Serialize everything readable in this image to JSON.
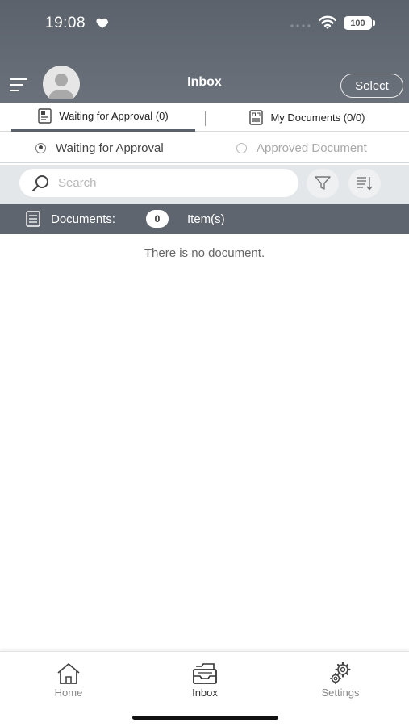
{
  "status_bar": {
    "time": "19:08",
    "battery": "100"
  },
  "nav": {
    "title": "Inbox",
    "select_label": "Select"
  },
  "tabs": [
    {
      "label": "Waiting for Approval (0)",
      "active": true
    },
    {
      "label": "My Documents (0/0)",
      "active": false
    }
  ],
  "filter": {
    "options": [
      {
        "label": "Waiting for Approval",
        "selected": true
      },
      {
        "label": "Approved Document",
        "selected": false
      }
    ]
  },
  "search": {
    "placeholder": "Search",
    "value": ""
  },
  "documents_bar": {
    "label": "Documents:",
    "count": "0",
    "unit": "Item(s)"
  },
  "empty_message": "There is no document.",
  "bottom_nav": {
    "items": [
      {
        "label": "Home",
        "icon": "home-icon",
        "active": false
      },
      {
        "label": "Inbox",
        "icon": "inbox-icon",
        "active": true
      },
      {
        "label": "Settings",
        "icon": "gear-icon",
        "active": false
      }
    ]
  },
  "colors": {
    "header": "#5b626c",
    "docs_bar": "#5e656e",
    "search_row": "#e4e7ea"
  }
}
